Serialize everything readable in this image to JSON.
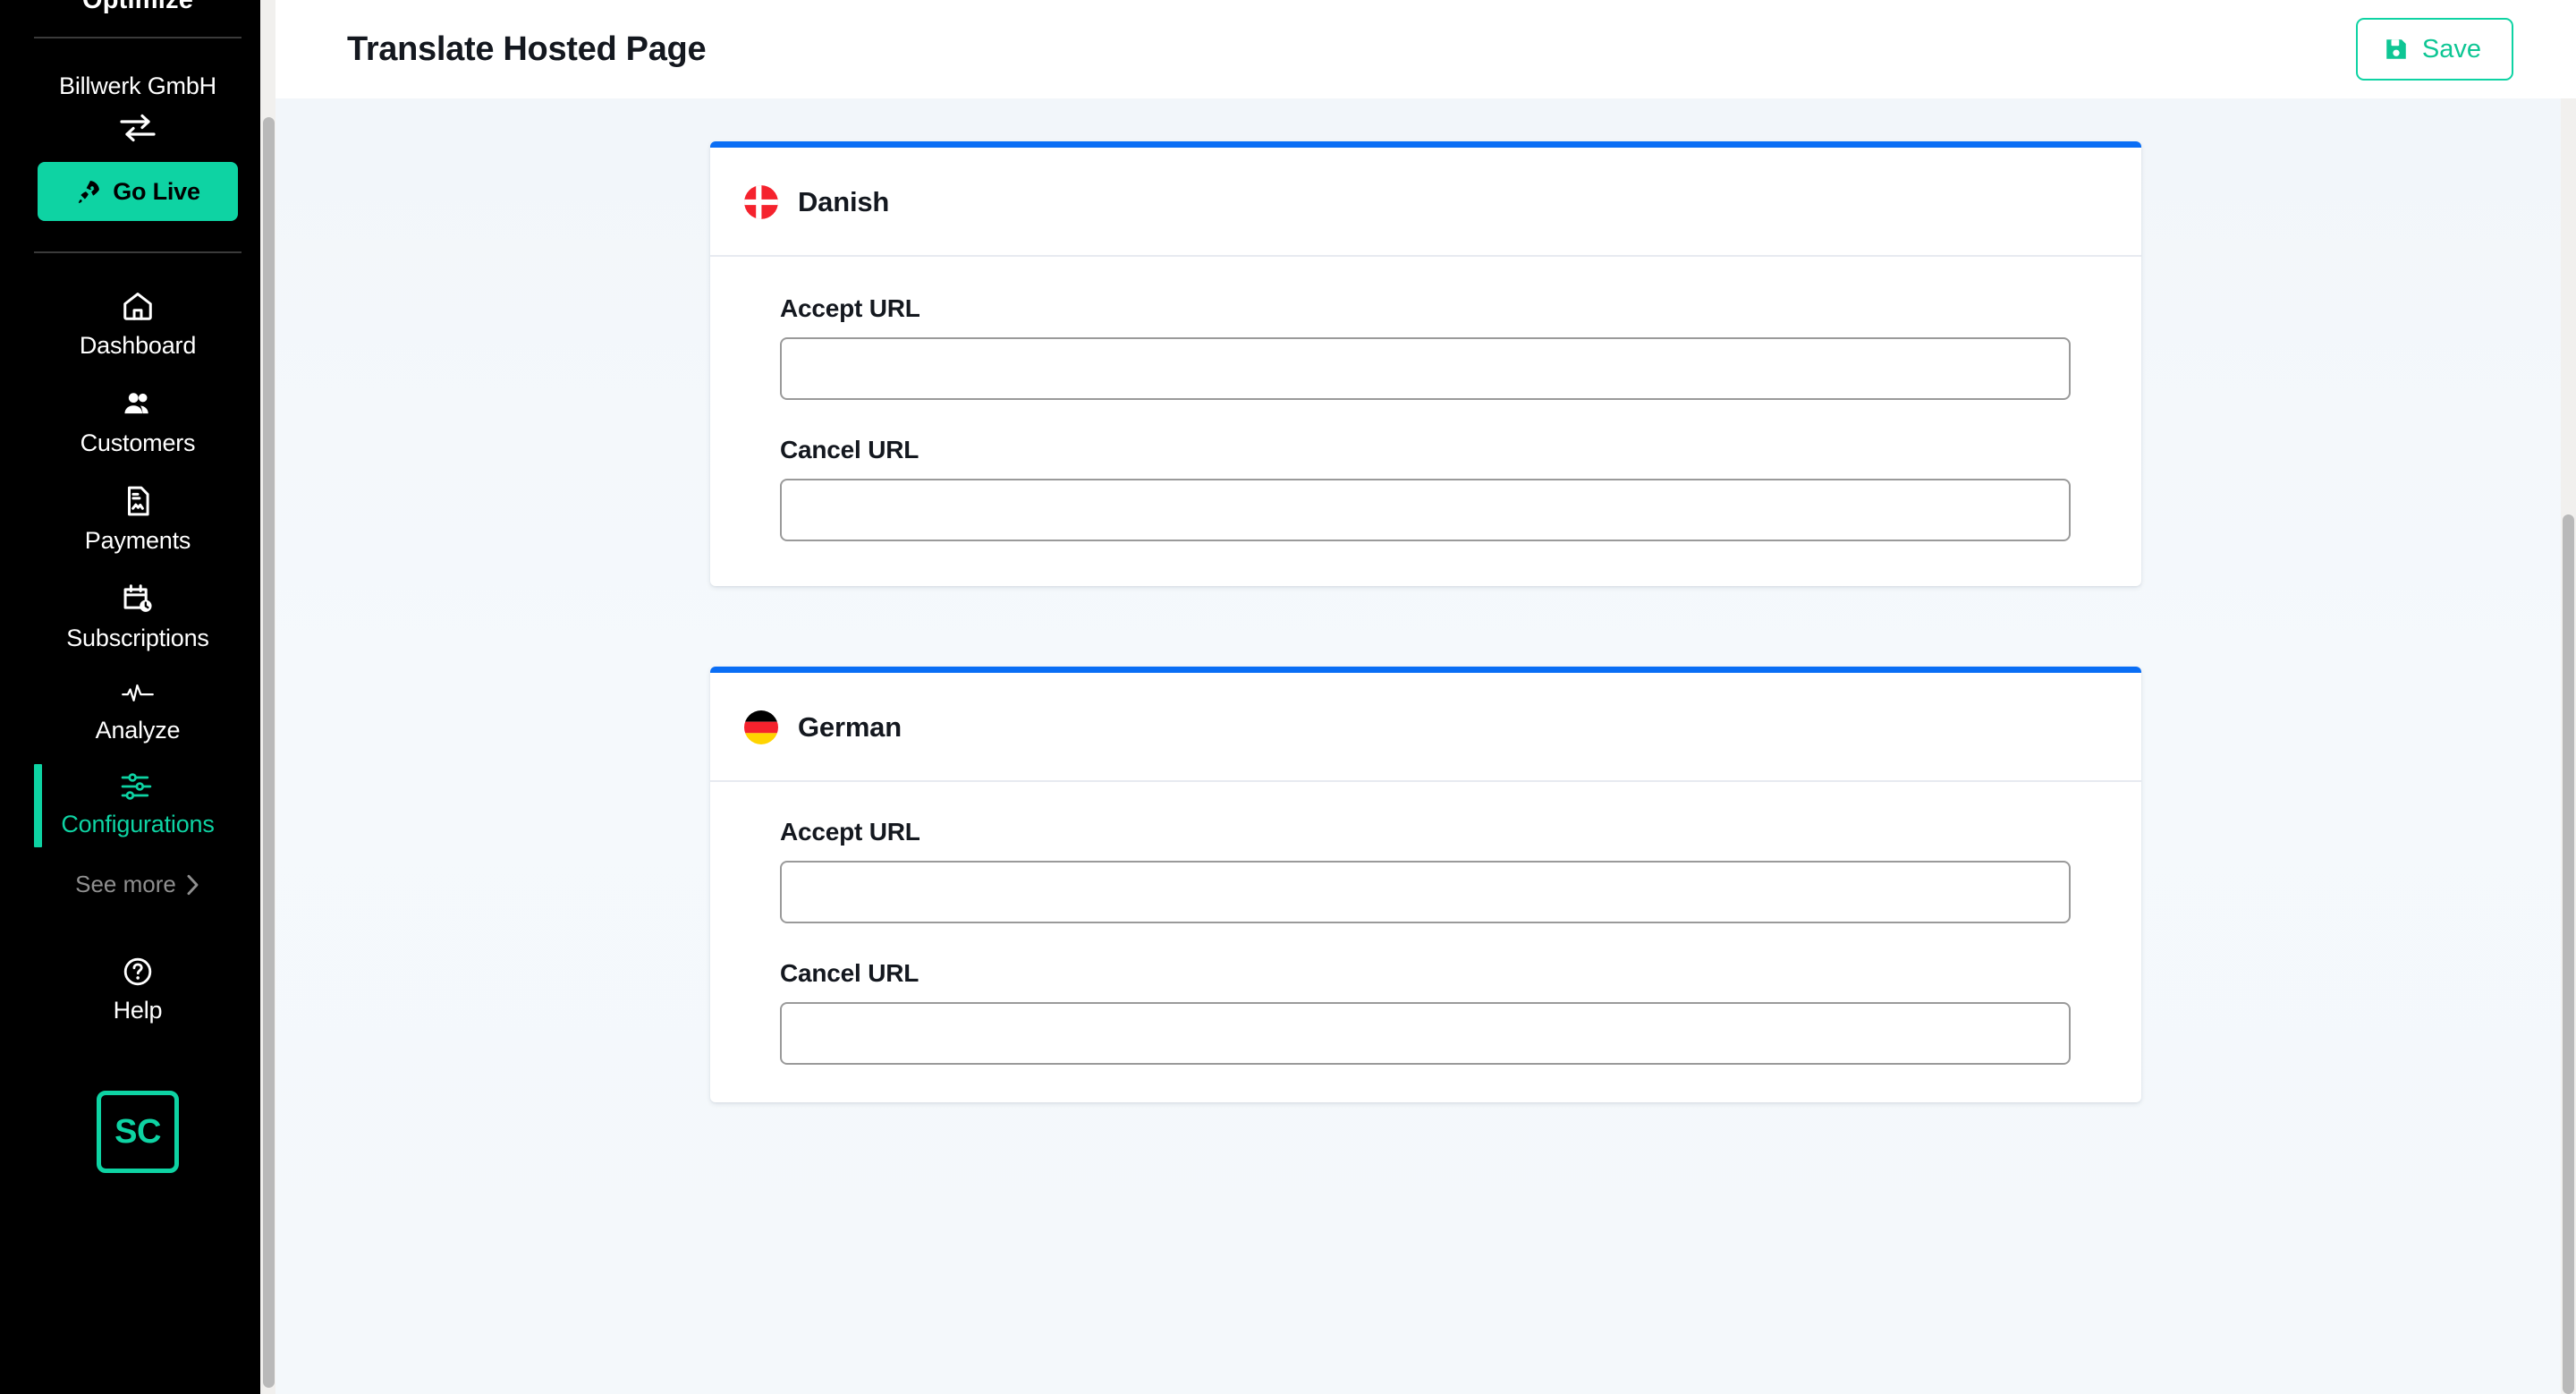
{
  "sidebar": {
    "brand": "Optimize",
    "org_name": "Billwerk GmbH",
    "switch_icon": "swap-arrows-icon",
    "go_live": {
      "label": "Go Live",
      "icon": "rocket-icon",
      "bg": "#0ed3a3"
    },
    "nav": [
      {
        "label": "Dashboard",
        "icon": "home-icon",
        "active": false
      },
      {
        "label": "Customers",
        "icon": "users-icon",
        "active": false
      },
      {
        "label": "Payments",
        "icon": "document-chart-icon",
        "active": false
      },
      {
        "label": "Subscriptions",
        "icon": "calendar-clock-icon",
        "active": false
      },
      {
        "label": "Analyze",
        "icon": "pulse-icon",
        "active": false
      },
      {
        "label": "Configurations",
        "icon": "sliders-icon",
        "active": true
      }
    ],
    "see_more": {
      "label": "See more",
      "icon": "chevron-right-icon"
    },
    "help": {
      "label": "Help",
      "icon": "question-circle-icon"
    },
    "account_badge": "SC",
    "accent_color": "#0ed3a3"
  },
  "header": {
    "title": "Translate Hosted Page",
    "save": {
      "label": "Save",
      "icon": "floppy-disk-icon",
      "color": "#0ec694"
    }
  },
  "main": {
    "accent_top_border": "#0a6ef5",
    "cards": [
      {
        "language": "Danish",
        "flag": "flag-denmark-icon",
        "fields": [
          {
            "label": "Accept URL",
            "value": "",
            "placeholder": ""
          },
          {
            "label": "Cancel URL",
            "value": "",
            "placeholder": ""
          }
        ]
      },
      {
        "language": "German",
        "flag": "flag-germany-icon",
        "fields": [
          {
            "label": "Accept URL",
            "value": "",
            "placeholder": ""
          },
          {
            "label": "Cancel URL",
            "value": "",
            "placeholder": ""
          }
        ]
      }
    ]
  }
}
